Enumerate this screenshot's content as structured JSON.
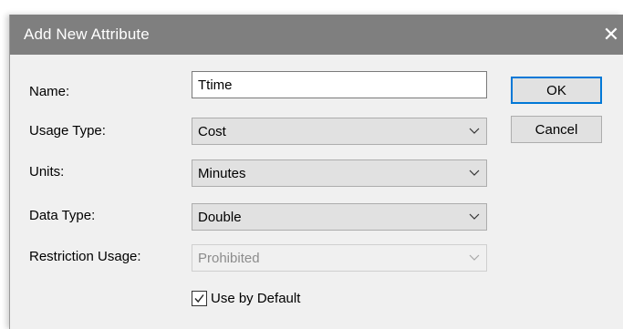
{
  "dialog": {
    "title": "Add New Attribute",
    "close_glyph": "✕"
  },
  "fields": {
    "name": {
      "label": "Name:",
      "value": "Ttime"
    },
    "usage_type": {
      "label": "Usage Type:",
      "value": "Cost"
    },
    "units": {
      "label": "Units:",
      "value": "Minutes"
    },
    "data_type": {
      "label": "Data Type:",
      "value": "Double"
    },
    "restriction_usage": {
      "label": "Restriction Usage:",
      "value": "Prohibited",
      "enabled": false
    }
  },
  "buttons": {
    "ok": "OK",
    "cancel": "Cancel"
  },
  "use_by_default": {
    "label": "Use by Default",
    "checked": true
  },
  "icons": {
    "dropdown": "chevron-down-icon",
    "close": "close-icon",
    "check": "checkmark-icon"
  },
  "colors": {
    "titlebar": "#7f7f7f",
    "default_button_border": "#0078d7"
  }
}
